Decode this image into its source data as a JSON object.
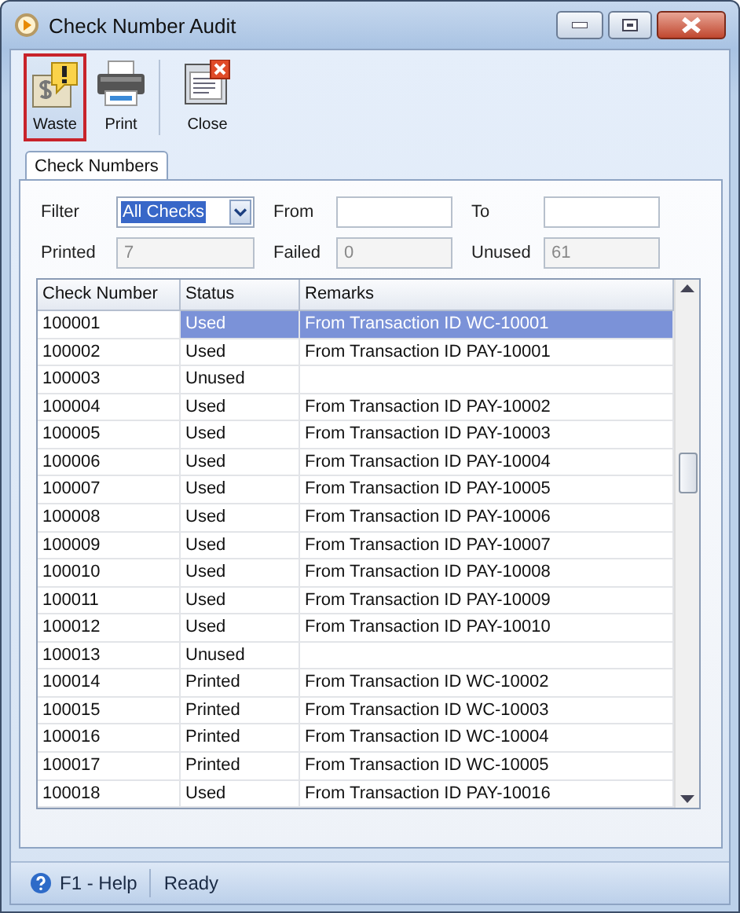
{
  "window": {
    "title": "Check Number Audit"
  },
  "toolbar": [
    {
      "label": "Waste",
      "kind": "waste",
      "selected": true
    },
    {
      "label": "Print",
      "kind": "print",
      "selected": false
    },
    {
      "label": "Close",
      "kind": "close",
      "selected": false
    }
  ],
  "tabs": [
    {
      "label": "Check Numbers",
      "selected": true
    }
  ],
  "filters": {
    "filter_label": "Filter",
    "filter_value": "All Checks",
    "from_label": "From",
    "to_label": "To",
    "printed_label": "Printed",
    "printed_value": "7",
    "failed_label": "Failed",
    "failed_value": "0",
    "unused_label": "Unused",
    "unused_value": "61"
  },
  "table": {
    "columns": [
      "Check Number",
      "Status",
      "Remarks"
    ],
    "rows": [
      {
        "cells": [
          "100001",
          "Used",
          "From Transaction ID WC-10001"
        ],
        "selected": true
      },
      {
        "cells": [
          "100002",
          "Used",
          "From Transaction ID PAY-10001"
        ],
        "selected": false
      },
      {
        "cells": [
          "100003",
          "Unused",
          ""
        ],
        "selected": false
      },
      {
        "cells": [
          "100004",
          "Used",
          "From Transaction ID PAY-10002"
        ],
        "selected": false
      },
      {
        "cells": [
          "100005",
          "Used",
          "From Transaction ID PAY-10003"
        ],
        "selected": false
      },
      {
        "cells": [
          "100006",
          "Used",
          "From Transaction ID PAY-10004"
        ],
        "selected": false
      },
      {
        "cells": [
          "100007",
          "Used",
          "From Transaction ID PAY-10005"
        ],
        "selected": false
      },
      {
        "cells": [
          "100008",
          "Used",
          "From Transaction ID PAY-10006"
        ],
        "selected": false
      },
      {
        "cells": [
          "100009",
          "Used",
          "From Transaction ID PAY-10007"
        ],
        "selected": false
      },
      {
        "cells": [
          "100010",
          "Used",
          "From Transaction ID PAY-10008"
        ],
        "selected": false
      },
      {
        "cells": [
          "100011",
          "Used",
          "From Transaction ID PAY-10009"
        ],
        "selected": false
      },
      {
        "cells": [
          "100012",
          "Used",
          "From Transaction ID PAY-10010"
        ],
        "selected": false
      },
      {
        "cells": [
          "100013",
          "Unused",
          ""
        ],
        "selected": false
      },
      {
        "cells": [
          "100014",
          "Printed",
          "From Transaction ID WC-10002"
        ],
        "selected": false
      },
      {
        "cells": [
          "100015",
          "Printed",
          "From Transaction ID WC-10003"
        ],
        "selected": false
      },
      {
        "cells": [
          "100016",
          "Printed",
          "From Transaction ID WC-10004"
        ],
        "selected": false
      },
      {
        "cells": [
          "100017",
          "Printed",
          "From Transaction ID WC-10005"
        ],
        "selected": false
      },
      {
        "cells": [
          "100018",
          "Used",
          "From Transaction ID PAY-10016"
        ],
        "selected": false
      }
    ]
  },
  "status_bar": {
    "help": "F1 - Help",
    "status": "Ready"
  }
}
